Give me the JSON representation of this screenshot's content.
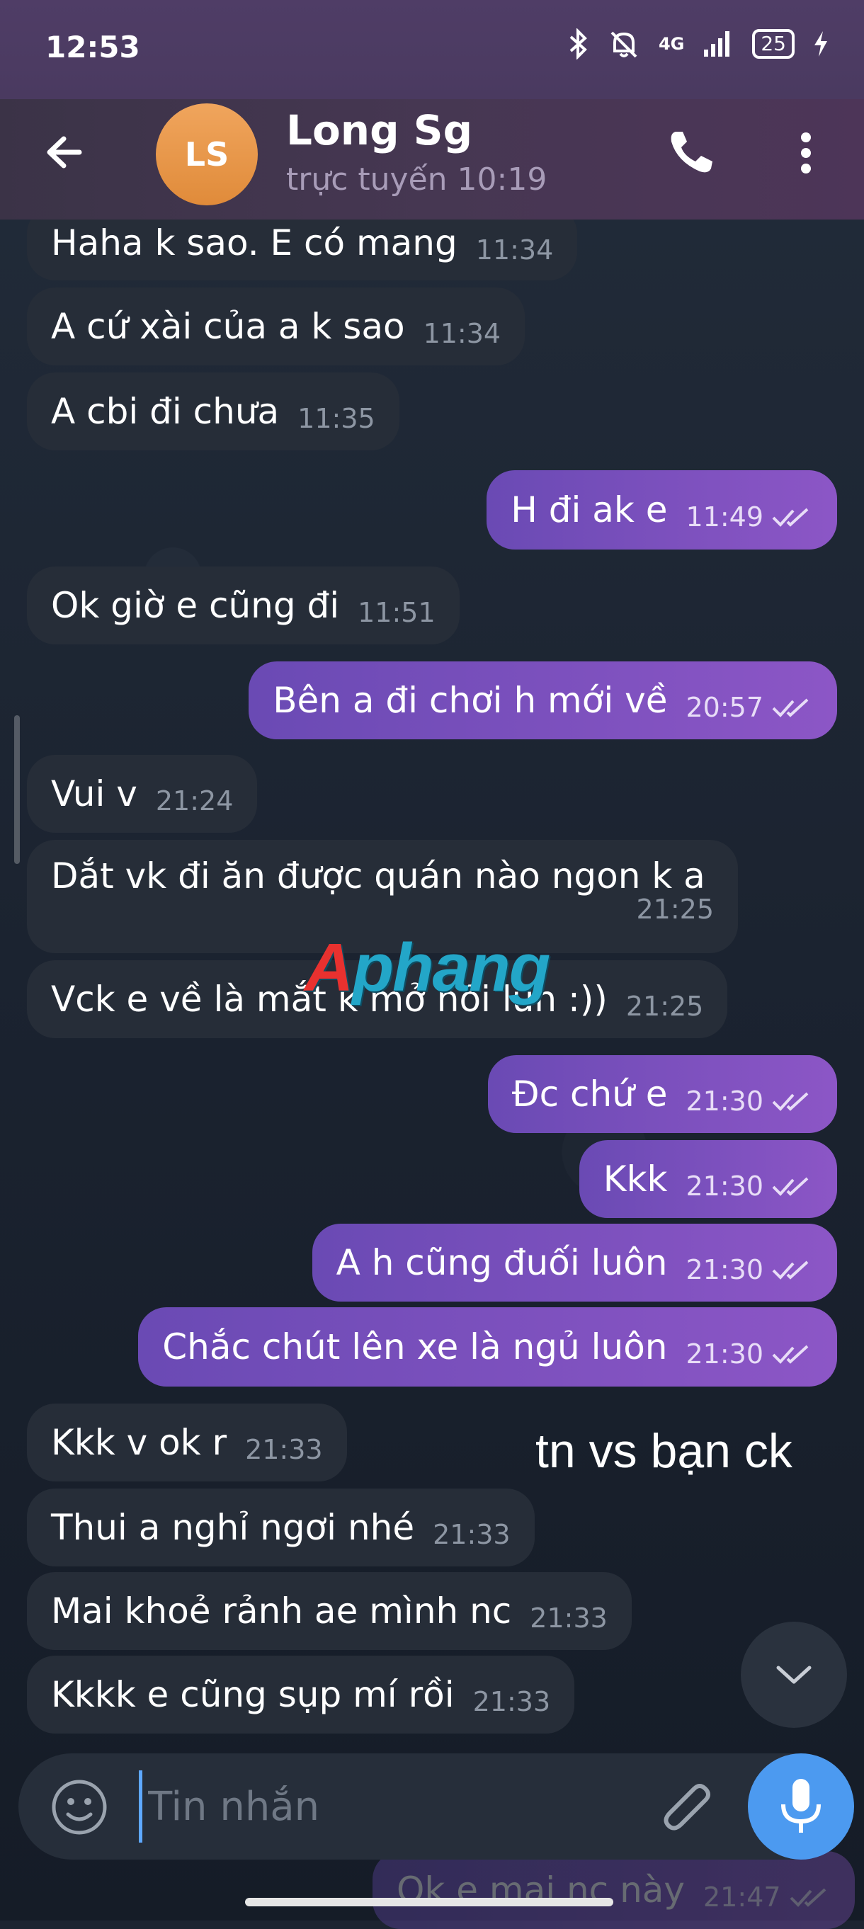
{
  "status_bar": {
    "time": "12:53",
    "network": "4G",
    "battery": "25"
  },
  "header": {
    "avatar_initials": "LS",
    "contact_name": "Long Sg",
    "contact_status": "trực tuyến 10:19"
  },
  "messages": [
    {
      "dir": "in",
      "text": "Haha k sao. E có mang",
      "time": "11:34"
    },
    {
      "dir": "in",
      "text": "A cứ xài của a k sao",
      "time": "11:34"
    },
    {
      "dir": "in",
      "text": "A cbi đi chưa",
      "time": "11:35"
    },
    {
      "dir": "out",
      "text": "H đi ak e",
      "time": "11:49",
      "read": true
    },
    {
      "dir": "in",
      "text": "Ok giờ e cũng đi",
      "time": "11:51"
    },
    {
      "dir": "out",
      "text": "Bên a đi chơi h mới về",
      "time": "20:57",
      "read": true
    },
    {
      "dir": "in",
      "text": "Vui v",
      "time": "21:24"
    },
    {
      "dir": "in",
      "text": "Dắt vk đi ăn được quán nào ngon k a",
      "time": "21:25"
    },
    {
      "dir": "in",
      "text": "Vck e về là mắt k mở nổi lun :))",
      "time": "21:25"
    },
    {
      "dir": "out",
      "text": "Đc chứ e",
      "time": "21:30",
      "read": true
    },
    {
      "dir": "out",
      "text": "Kkk",
      "time": "21:30",
      "read": true
    },
    {
      "dir": "out",
      "text": "A h cũng đuối luôn",
      "time": "21:30",
      "read": true
    },
    {
      "dir": "out",
      "text": "Chắc chút lên xe là ngủ luôn",
      "time": "21:30",
      "read": true
    },
    {
      "dir": "in",
      "text": "Kkk v ok r",
      "time": "21:33"
    },
    {
      "dir": "in",
      "text": "Thui a nghỉ ngơi nhé",
      "time": "21:33"
    },
    {
      "dir": "in",
      "text": "Mai khoẻ rảnh ae mình nc",
      "time": "21:33"
    },
    {
      "dir": "in",
      "text": "Kkkk e cũng sụp mí rồi",
      "time": "21:33"
    },
    {
      "dir": "out",
      "text": "Ok e,mai nc này",
      "time": "21:47",
      "read": true
    }
  ],
  "watermark": {
    "first": "A",
    "rest": "phang"
  },
  "overlay_note": "tn vs bạn ck",
  "composer": {
    "placeholder": "Tin nhắn"
  },
  "colors": {
    "header_bg": "#463752",
    "incoming_bubble": "#262d38",
    "outgoing_bubble": "#7b50bd",
    "avatar": "#e8963f",
    "mic_button": "#4c9af0"
  },
  "icons": {
    "back": "arrow-left-icon",
    "call": "phone-icon",
    "more": "more-vertical-icon",
    "emoji": "emoji-icon",
    "attach": "paperclip-icon",
    "mic": "microphone-icon",
    "scroll_down": "chevron-down-icon"
  }
}
